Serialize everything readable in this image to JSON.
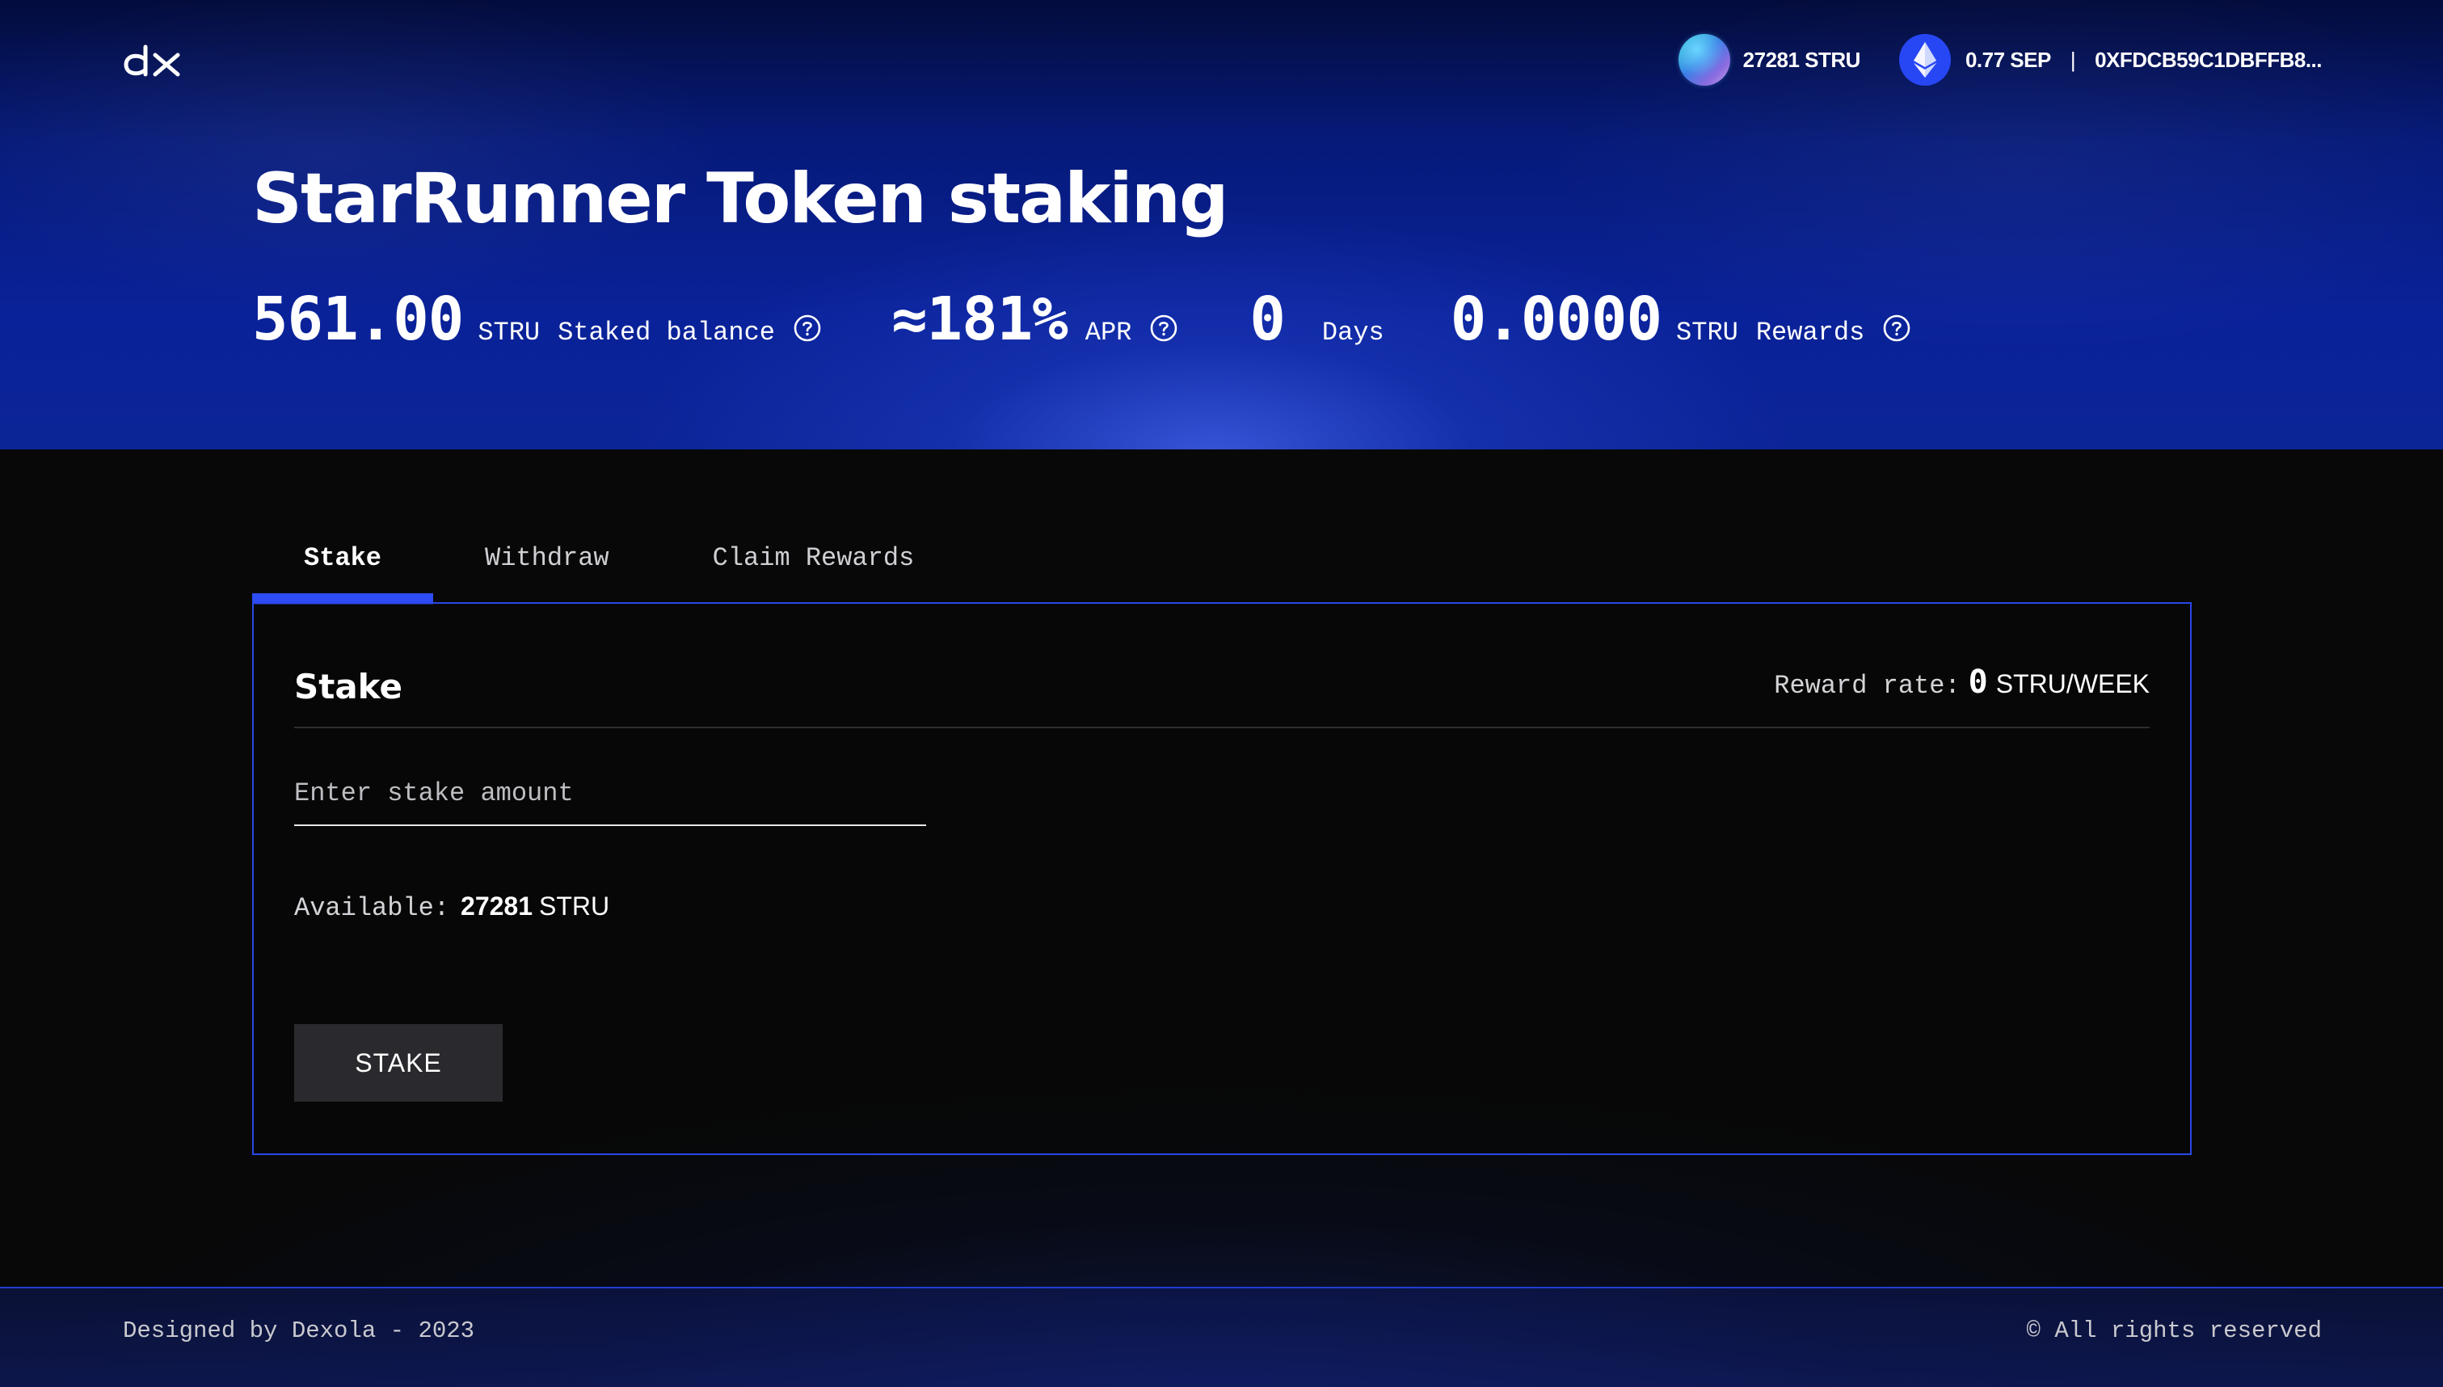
{
  "header": {
    "logo_text": "dx",
    "token_balance": "27281 STRU",
    "eth_balance": "0.77 SEP",
    "separator": "|",
    "address": "0XFDCB59C1DBFFB8..."
  },
  "hero": {
    "title": "StarRunner Token staking",
    "stats": {
      "staked": {
        "value": "561.00",
        "unit": "STRU",
        "label": "Staked balance"
      },
      "apr": {
        "value": "≈181%",
        "label": "APR"
      },
      "days": {
        "value": "0",
        "label": "Days"
      },
      "rewards": {
        "value": "0.0000",
        "unit": "STRU",
        "label": "Rewards"
      }
    }
  },
  "tabs": [
    {
      "label": "Stake",
      "active": true
    },
    {
      "label": "Withdraw",
      "active": false
    },
    {
      "label": "Claim Rewards",
      "active": false
    }
  ],
  "panel": {
    "title": "Stake",
    "reward_rate_label": "Reward rate:",
    "reward_rate_value": "0",
    "reward_rate_unit": "STRU/WEEK",
    "input_placeholder": "Enter stake amount",
    "input_value": "",
    "available_label": "Available:",
    "available_value": "27281",
    "available_unit": "STRU",
    "button_label": "STAKE"
  },
  "footer": {
    "left": "Designed by Dexola - 2023",
    "right": "© All rights reserved"
  },
  "colors": {
    "accent": "#2d4cf6",
    "panel_border": "#2a47e6",
    "hero_dark": "#030c3c",
    "hero_mid": "#0a2299",
    "background": "#080808",
    "button_bg": "#2a2a2e"
  },
  "icons": [
    "dx-logo-icon",
    "stru-token-icon",
    "ethereum-icon",
    "question-circle-icon"
  ]
}
